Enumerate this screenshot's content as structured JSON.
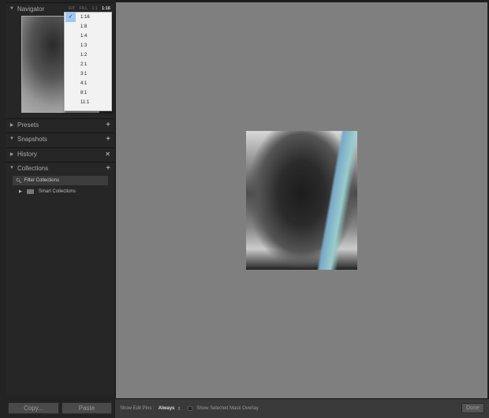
{
  "navigator": {
    "title": "Navigator",
    "zoom_options": [
      "FIT",
      "FILL",
      "1:1"
    ],
    "current_zoom": "1:16",
    "dropdown": [
      "1:16",
      "1:8",
      "1:4",
      "1:3",
      "1:2",
      "2:1",
      "3:1",
      "4:1",
      "8:1",
      "11:1"
    ]
  },
  "panels": {
    "presets": "Presets",
    "snapshots": "Snapshots",
    "history": "History",
    "collections": "Collections"
  },
  "collections": {
    "filter": "Filter Collections",
    "smart": "Smart Collections"
  },
  "buttons": {
    "copy": "Copy...",
    "paste": "Paste",
    "done": "Done"
  },
  "toolbar": {
    "edit_pins_label": "Show Edit Pins :",
    "edit_pins_value": "Always",
    "mask_overlay": "Show Selected Mask Overlay"
  }
}
